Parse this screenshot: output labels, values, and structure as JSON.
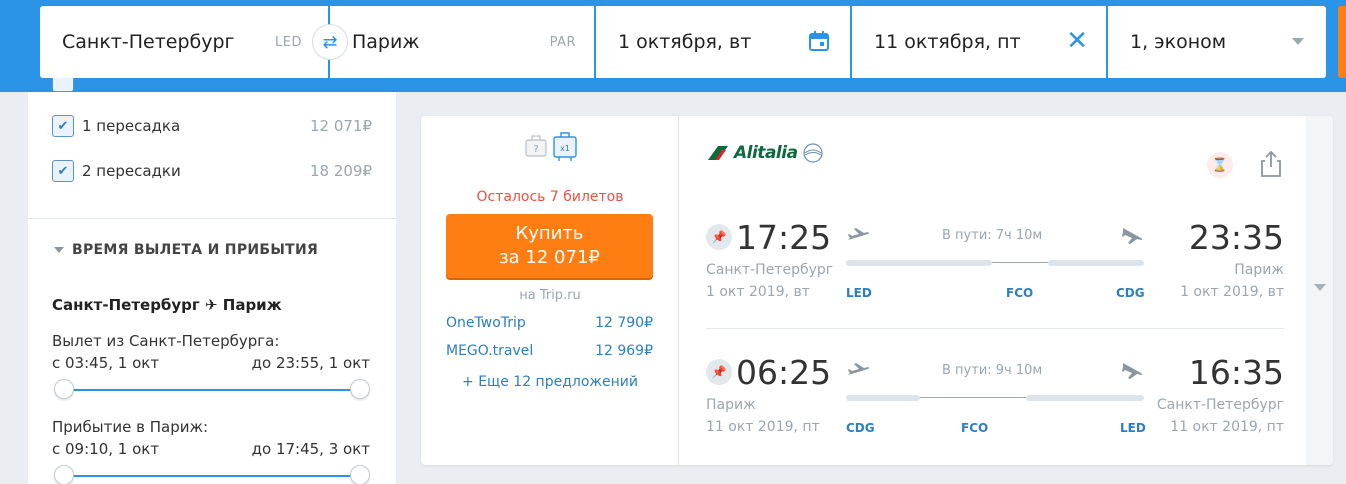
{
  "search": {
    "origin": "Санкт-Петербург",
    "origin_code": "LED",
    "destination": "Париж",
    "destination_code": "PAR",
    "depart_date": "1 октября, вт",
    "return_date": "11 октября, пт",
    "passengers": "1, эконом"
  },
  "filters": {
    "stops": [
      {
        "label": "1 пересадка",
        "price": "12 071₽",
        "checked": true
      },
      {
        "label": "2 пересадки",
        "price": "18 209₽",
        "checked": true
      }
    ],
    "section_title": "ВРЕМЯ ВЫЛЕТА И ПРИБЫТИЯ",
    "route_title": "Санкт-Петербург ✈ Париж",
    "departure_label": "Вылет из Санкт-Петербурга:",
    "departure_from": "с 03:45, 1 окт",
    "departure_to": "до 23:55, 1 окт",
    "arrival_label": "Прибытие в Париж:",
    "arrival_from": "с 09:10, 1 окт",
    "arrival_to": "до 17:45, 3 окт"
  },
  "ticket": {
    "baggage_badge": "x1",
    "seats_left": "Осталось 7 билетов",
    "buy_line1": "Купить",
    "buy_line2": "за 12 071₽",
    "buy_site": "на Trip.ru",
    "offers": [
      {
        "agency": "OneTwoTrip",
        "price": "12 790₽"
      },
      {
        "agency": "MEGO.travel",
        "price": "12 969₽"
      }
    ],
    "more_offers": "+ Еще 12 предложений",
    "airline": "Alitalia",
    "segments": [
      {
        "dep_time": "17:25",
        "arr_time": "23:35",
        "dep_city": "Санкт-Петербург",
        "arr_city": "Париж",
        "dep_date": "1 окт 2019, вт",
        "arr_date": "1 окт 2019, вт",
        "duration": "В пути: 7ч 10м",
        "dep_code": "LED",
        "stop_code": "FCO",
        "arr_code": "CDG"
      },
      {
        "dep_time": "06:25",
        "arr_time": "16:35",
        "dep_city": "Париж",
        "arr_city": "Санкт-Петербург",
        "dep_date": "11 окт 2019, пт",
        "arr_date": "11 окт 2019, пт",
        "duration": "В пути: 9ч 10м",
        "dep_code": "CDG",
        "stop_code": "FCO",
        "arr_code": "LED"
      }
    ]
  },
  "colors": {
    "brand_blue": "#2b94e6",
    "buy_orange": "#ff7e14",
    "alert_red": "#e8523f",
    "link_blue": "#2b7fc4"
  }
}
